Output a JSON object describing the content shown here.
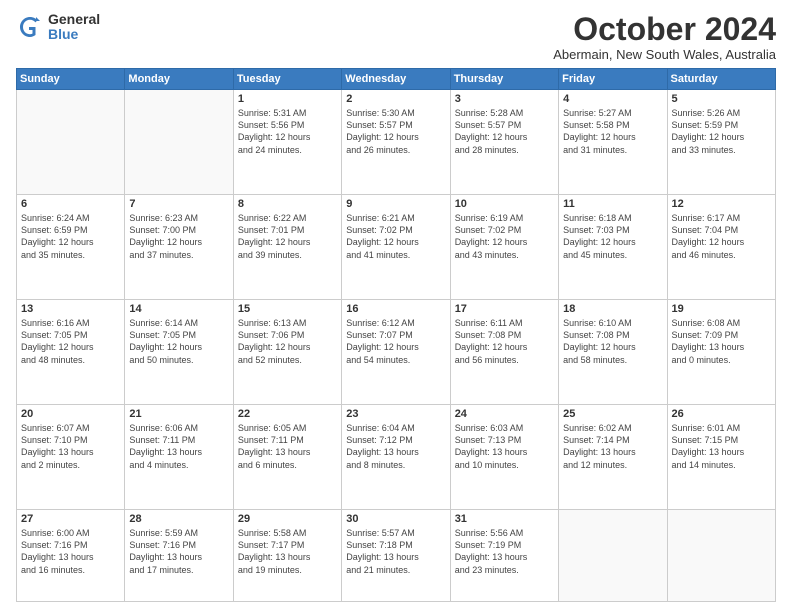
{
  "logo": {
    "general": "General",
    "blue": "Blue"
  },
  "title": "October 2024",
  "subtitle": "Abermain, New South Wales, Australia",
  "days_header": [
    "Sunday",
    "Monday",
    "Tuesday",
    "Wednesday",
    "Thursday",
    "Friday",
    "Saturday"
  ],
  "weeks": [
    [
      {
        "day": "",
        "info": ""
      },
      {
        "day": "",
        "info": ""
      },
      {
        "day": "1",
        "info": "Sunrise: 5:31 AM\nSunset: 5:56 PM\nDaylight: 12 hours\nand 24 minutes."
      },
      {
        "day": "2",
        "info": "Sunrise: 5:30 AM\nSunset: 5:57 PM\nDaylight: 12 hours\nand 26 minutes."
      },
      {
        "day": "3",
        "info": "Sunrise: 5:28 AM\nSunset: 5:57 PM\nDaylight: 12 hours\nand 28 minutes."
      },
      {
        "day": "4",
        "info": "Sunrise: 5:27 AM\nSunset: 5:58 PM\nDaylight: 12 hours\nand 31 minutes."
      },
      {
        "day": "5",
        "info": "Sunrise: 5:26 AM\nSunset: 5:59 PM\nDaylight: 12 hours\nand 33 minutes."
      }
    ],
    [
      {
        "day": "6",
        "info": "Sunrise: 6:24 AM\nSunset: 6:59 PM\nDaylight: 12 hours\nand 35 minutes."
      },
      {
        "day": "7",
        "info": "Sunrise: 6:23 AM\nSunset: 7:00 PM\nDaylight: 12 hours\nand 37 minutes."
      },
      {
        "day": "8",
        "info": "Sunrise: 6:22 AM\nSunset: 7:01 PM\nDaylight: 12 hours\nand 39 minutes."
      },
      {
        "day": "9",
        "info": "Sunrise: 6:21 AM\nSunset: 7:02 PM\nDaylight: 12 hours\nand 41 minutes."
      },
      {
        "day": "10",
        "info": "Sunrise: 6:19 AM\nSunset: 7:02 PM\nDaylight: 12 hours\nand 43 minutes."
      },
      {
        "day": "11",
        "info": "Sunrise: 6:18 AM\nSunset: 7:03 PM\nDaylight: 12 hours\nand 45 minutes."
      },
      {
        "day": "12",
        "info": "Sunrise: 6:17 AM\nSunset: 7:04 PM\nDaylight: 12 hours\nand 46 minutes."
      }
    ],
    [
      {
        "day": "13",
        "info": "Sunrise: 6:16 AM\nSunset: 7:05 PM\nDaylight: 12 hours\nand 48 minutes."
      },
      {
        "day": "14",
        "info": "Sunrise: 6:14 AM\nSunset: 7:05 PM\nDaylight: 12 hours\nand 50 minutes."
      },
      {
        "day": "15",
        "info": "Sunrise: 6:13 AM\nSunset: 7:06 PM\nDaylight: 12 hours\nand 52 minutes."
      },
      {
        "day": "16",
        "info": "Sunrise: 6:12 AM\nSunset: 7:07 PM\nDaylight: 12 hours\nand 54 minutes."
      },
      {
        "day": "17",
        "info": "Sunrise: 6:11 AM\nSunset: 7:08 PM\nDaylight: 12 hours\nand 56 minutes."
      },
      {
        "day": "18",
        "info": "Sunrise: 6:10 AM\nSunset: 7:08 PM\nDaylight: 12 hours\nand 58 minutes."
      },
      {
        "day": "19",
        "info": "Sunrise: 6:08 AM\nSunset: 7:09 PM\nDaylight: 13 hours\nand 0 minutes."
      }
    ],
    [
      {
        "day": "20",
        "info": "Sunrise: 6:07 AM\nSunset: 7:10 PM\nDaylight: 13 hours\nand 2 minutes."
      },
      {
        "day": "21",
        "info": "Sunrise: 6:06 AM\nSunset: 7:11 PM\nDaylight: 13 hours\nand 4 minutes."
      },
      {
        "day": "22",
        "info": "Sunrise: 6:05 AM\nSunset: 7:11 PM\nDaylight: 13 hours\nand 6 minutes."
      },
      {
        "day": "23",
        "info": "Sunrise: 6:04 AM\nSunset: 7:12 PM\nDaylight: 13 hours\nand 8 minutes."
      },
      {
        "day": "24",
        "info": "Sunrise: 6:03 AM\nSunset: 7:13 PM\nDaylight: 13 hours\nand 10 minutes."
      },
      {
        "day": "25",
        "info": "Sunrise: 6:02 AM\nSunset: 7:14 PM\nDaylight: 13 hours\nand 12 minutes."
      },
      {
        "day": "26",
        "info": "Sunrise: 6:01 AM\nSunset: 7:15 PM\nDaylight: 13 hours\nand 14 minutes."
      }
    ],
    [
      {
        "day": "27",
        "info": "Sunrise: 6:00 AM\nSunset: 7:16 PM\nDaylight: 13 hours\nand 16 minutes."
      },
      {
        "day": "28",
        "info": "Sunrise: 5:59 AM\nSunset: 7:16 PM\nDaylight: 13 hours\nand 17 minutes."
      },
      {
        "day": "29",
        "info": "Sunrise: 5:58 AM\nSunset: 7:17 PM\nDaylight: 13 hours\nand 19 minutes."
      },
      {
        "day": "30",
        "info": "Sunrise: 5:57 AM\nSunset: 7:18 PM\nDaylight: 13 hours\nand 21 minutes."
      },
      {
        "day": "31",
        "info": "Sunrise: 5:56 AM\nSunset: 7:19 PM\nDaylight: 13 hours\nand 23 minutes."
      },
      {
        "day": "",
        "info": ""
      },
      {
        "day": "",
        "info": ""
      }
    ]
  ]
}
